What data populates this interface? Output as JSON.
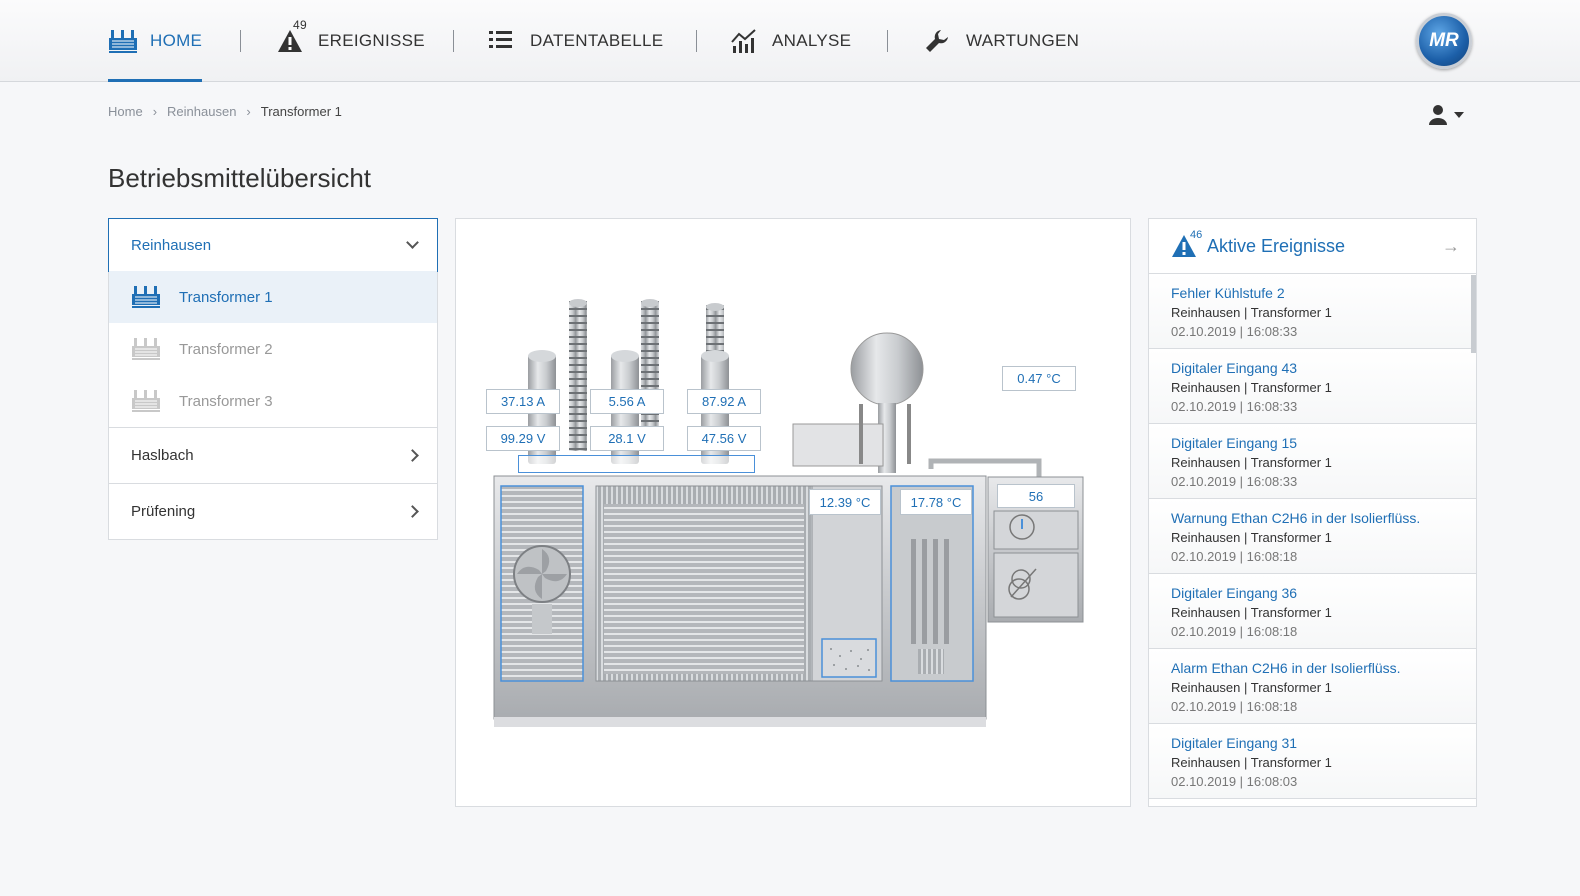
{
  "nav": {
    "items": [
      {
        "label": "HOME",
        "icon": "transformer-icon",
        "active": true
      },
      {
        "label": "EREIGNISSE",
        "icon": "warning-icon",
        "badge": "49"
      },
      {
        "label": "DATENTABELLE",
        "icon": "list-icon"
      },
      {
        "label": "ANALYSE",
        "icon": "chart-icon"
      },
      {
        "label": "WARTUNGEN",
        "icon": "wrench-icon"
      }
    ],
    "logo": "MR"
  },
  "breadcrumb": [
    "Home",
    "Reinhausen",
    "Transformer 1"
  ],
  "page_title": "Betriebsmittelübersicht",
  "tree": {
    "groups": [
      {
        "label": "Reinhausen",
        "items": [
          "Transformer 1",
          "Transformer 2",
          "Transformer 3"
        ]
      },
      {
        "label": "Haslbach"
      },
      {
        "label": "Prüfening"
      }
    ]
  },
  "transformer": {
    "currents": [
      "37.13 A",
      "5.56 A",
      "87.92 A"
    ],
    "voltages": [
      "99.29 V",
      "28.1 V",
      "47.56 V"
    ],
    "temp_ambient": "0.47 °C",
    "temp_oil": "12.39 °C",
    "temp_winding": "17.78 °C",
    "tap_position": "56"
  },
  "events": {
    "title": "Aktive Ereignisse",
    "count": "46",
    "items": [
      {
        "title": "Fehler Kühlstufe 2",
        "location": "Reinhausen | Transformer 1",
        "time": "02.10.2019 | 16:08:33"
      },
      {
        "title": "Digitaler Eingang 43",
        "location": "Reinhausen | Transformer 1",
        "time": "02.10.2019 | 16:08:33"
      },
      {
        "title": "Digitaler Eingang 15",
        "location": "Reinhausen | Transformer 1",
        "time": "02.10.2019 | 16:08:33"
      },
      {
        "title": "Warnung Ethan C2H6 in der Isolierflüss.",
        "location": "Reinhausen | Transformer 1",
        "time": "02.10.2019 | 16:08:18"
      },
      {
        "title": "Digitaler Eingang 36",
        "location": "Reinhausen | Transformer 1",
        "time": "02.10.2019 | 16:08:18"
      },
      {
        "title": "Alarm Ethan C2H6 in der Isolierflüss.",
        "location": "Reinhausen | Transformer 1",
        "time": "02.10.2019 | 16:08:18"
      },
      {
        "title": "Digitaler Eingang 31",
        "location": "Reinhausen | Transformer 1",
        "time": "02.10.2019 | 16:08:03"
      }
    ]
  },
  "colors": {
    "accent": "#1f6fb5"
  }
}
